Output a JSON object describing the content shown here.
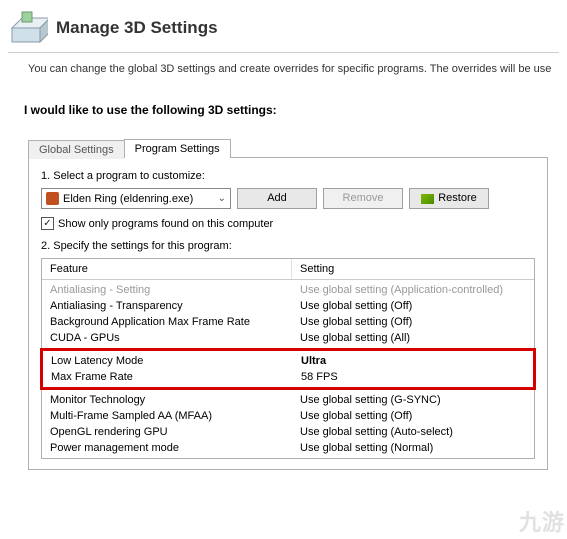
{
  "header": {
    "title": "Manage 3D Settings"
  },
  "description": "You can change the global 3D settings and create overrides for specific programs. The overrides will be use",
  "intro": "I would like to use the following 3D settings:",
  "tabs": {
    "global": "Global Settings",
    "program": "Program Settings"
  },
  "step1": "1. Select a program to customize:",
  "program_combo": "Elden Ring (eldenring.exe)",
  "buttons": {
    "add": "Add",
    "remove": "Remove",
    "restore": "Restore"
  },
  "checkbox_label": "Show only programs found on this computer",
  "step2": "2. Specify the settings for this program:",
  "table_headers": {
    "feature": "Feature",
    "setting": "Setting"
  },
  "rows": {
    "r0": {
      "f": "Antialiasing - Setting",
      "s": "Use global setting (Application-controlled)"
    },
    "r1": {
      "f": "Antialiasing - Transparency",
      "s": "Use global setting (Off)"
    },
    "r2": {
      "f": "Background Application Max Frame Rate",
      "s": "Use global setting (Off)"
    },
    "r3": {
      "f": "CUDA - GPUs",
      "s": "Use global setting (All)"
    },
    "r4": {
      "f": "Low Latency Mode",
      "s": "Ultra"
    },
    "r5": {
      "f": "Max Frame Rate",
      "s": "58 FPS"
    },
    "r6": {
      "f": "Monitor Technology",
      "s": "Use global setting (G-SYNC)"
    },
    "r7": {
      "f": "Multi-Frame Sampled AA (MFAA)",
      "s": "Use global setting (Off)"
    },
    "r8": {
      "f": "OpenGL rendering GPU",
      "s": "Use global setting (Auto-select)"
    },
    "r9": {
      "f": "Power management mode",
      "s": "Use global setting (Normal)"
    }
  },
  "watermark": "九游"
}
